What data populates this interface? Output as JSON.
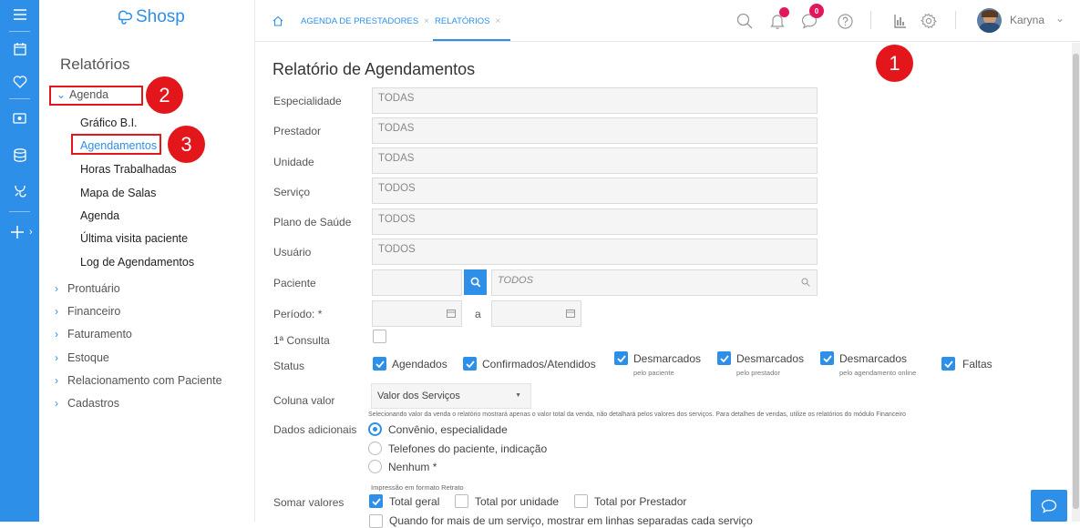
{
  "app": {
    "logo_text": "Shosp"
  },
  "rail": {
    "icons": [
      "menu-icon",
      "calendar-icon",
      "heart-icon",
      "money-icon",
      "database-icon",
      "medical-icon",
      "plus-icon",
      "chevron-right-icon"
    ]
  },
  "sidebar": {
    "title": "Relatórios",
    "groups": [
      {
        "label": "Agenda",
        "expanded": true
      },
      {
        "label": "Prontuário"
      },
      {
        "label": "Financeiro"
      },
      {
        "label": "Faturamento"
      },
      {
        "label": "Estoque"
      },
      {
        "label": "Relacionamento com Paciente"
      },
      {
        "label": "Cadastros"
      }
    ],
    "agenda_items": [
      {
        "label": "Gráfico B.I."
      },
      {
        "label": "Agendamentos",
        "active": true
      },
      {
        "label": "Horas Trabalhadas"
      },
      {
        "label": "Mapa de Salas"
      },
      {
        "label": "Agenda"
      },
      {
        "label": "Última visita paciente"
      },
      {
        "label": "Log de Agendamentos"
      }
    ]
  },
  "topbar": {
    "tabs": [
      {
        "label": "AGENDA DE PRESTADORES"
      },
      {
        "label": "RELATÓRIOS",
        "active": true
      }
    ],
    "chat_badge": "0",
    "user_name": "Karyna",
    "icons": [
      "home-icon",
      "search-icon",
      "bell-icon",
      "chat-icon",
      "help-icon",
      "reports-icon",
      "settings-icon",
      "avatar",
      "chevron-down-icon"
    ]
  },
  "annotations": {
    "n1": "1",
    "n2": "2",
    "n3": "3",
    "color": "#e3171b"
  },
  "form": {
    "title": "Relatório de Agendamentos",
    "fields": [
      {
        "label": "Especialidade",
        "value": "TODAS"
      },
      {
        "label": "Prestador",
        "value": "TODAS"
      },
      {
        "label": "Unidade",
        "value": "TODAS"
      },
      {
        "label": "Serviço",
        "value": "TODOS"
      },
      {
        "label": "Plano de Saúde",
        "value": "TODOS"
      },
      {
        "label": "Usuário",
        "value": "TODOS"
      }
    ],
    "paciente": {
      "label": "Paciente",
      "value": "",
      "search_value": "TODOS"
    },
    "periodo": {
      "label": "Período: *",
      "separator": "a",
      "start": "",
      "end": ""
    },
    "primeira_consulta": {
      "label": "1ª Consulta",
      "checked": false
    },
    "status": {
      "label": "Status",
      "options": [
        {
          "label": "Agendados",
          "sub": "",
          "checked": true
        },
        {
          "label": "Confirmados/Atendidos",
          "sub": "",
          "checked": true
        },
        {
          "label": "Desmarcados",
          "sub": "pelo paciente",
          "checked": true
        },
        {
          "label": "Desmarcados",
          "sub": "pelo prestador",
          "checked": true
        },
        {
          "label": "Desmarcados",
          "sub": "pelo agendamento online",
          "checked": true
        },
        {
          "label": "Faltas",
          "sub": "",
          "checked": true
        }
      ]
    },
    "coluna_valor": {
      "label": "Coluna valor",
      "selected": "Valor dos Serviços",
      "note": "Selecionando valor da venda o relatório mostrará apenas o valor total da venda, não detalhará pelos valores dos serviços. Para detalhes de vendas, utilize os relatórios do módulo Financeiro"
    },
    "dados_adicionais": {
      "label": "Dados adicionais",
      "options": [
        {
          "label": "Convênio, especialidade",
          "selected": true
        },
        {
          "label": "Telefones do paciente, indicação",
          "selected": false
        },
        {
          "label": "Nenhum *",
          "selected": false
        }
      ]
    },
    "impressao_note": "Impressão em formato Retrato",
    "somar_valores": {
      "label": "Somar valores",
      "options": [
        {
          "label": "Total geral",
          "checked": true
        },
        {
          "label": "Total por unidade",
          "checked": false
        },
        {
          "label": "Total por Prestador",
          "checked": false
        }
      ]
    },
    "cut_option": "Quando for mais de um serviço, mostrar em linhas separadas cada serviço"
  }
}
